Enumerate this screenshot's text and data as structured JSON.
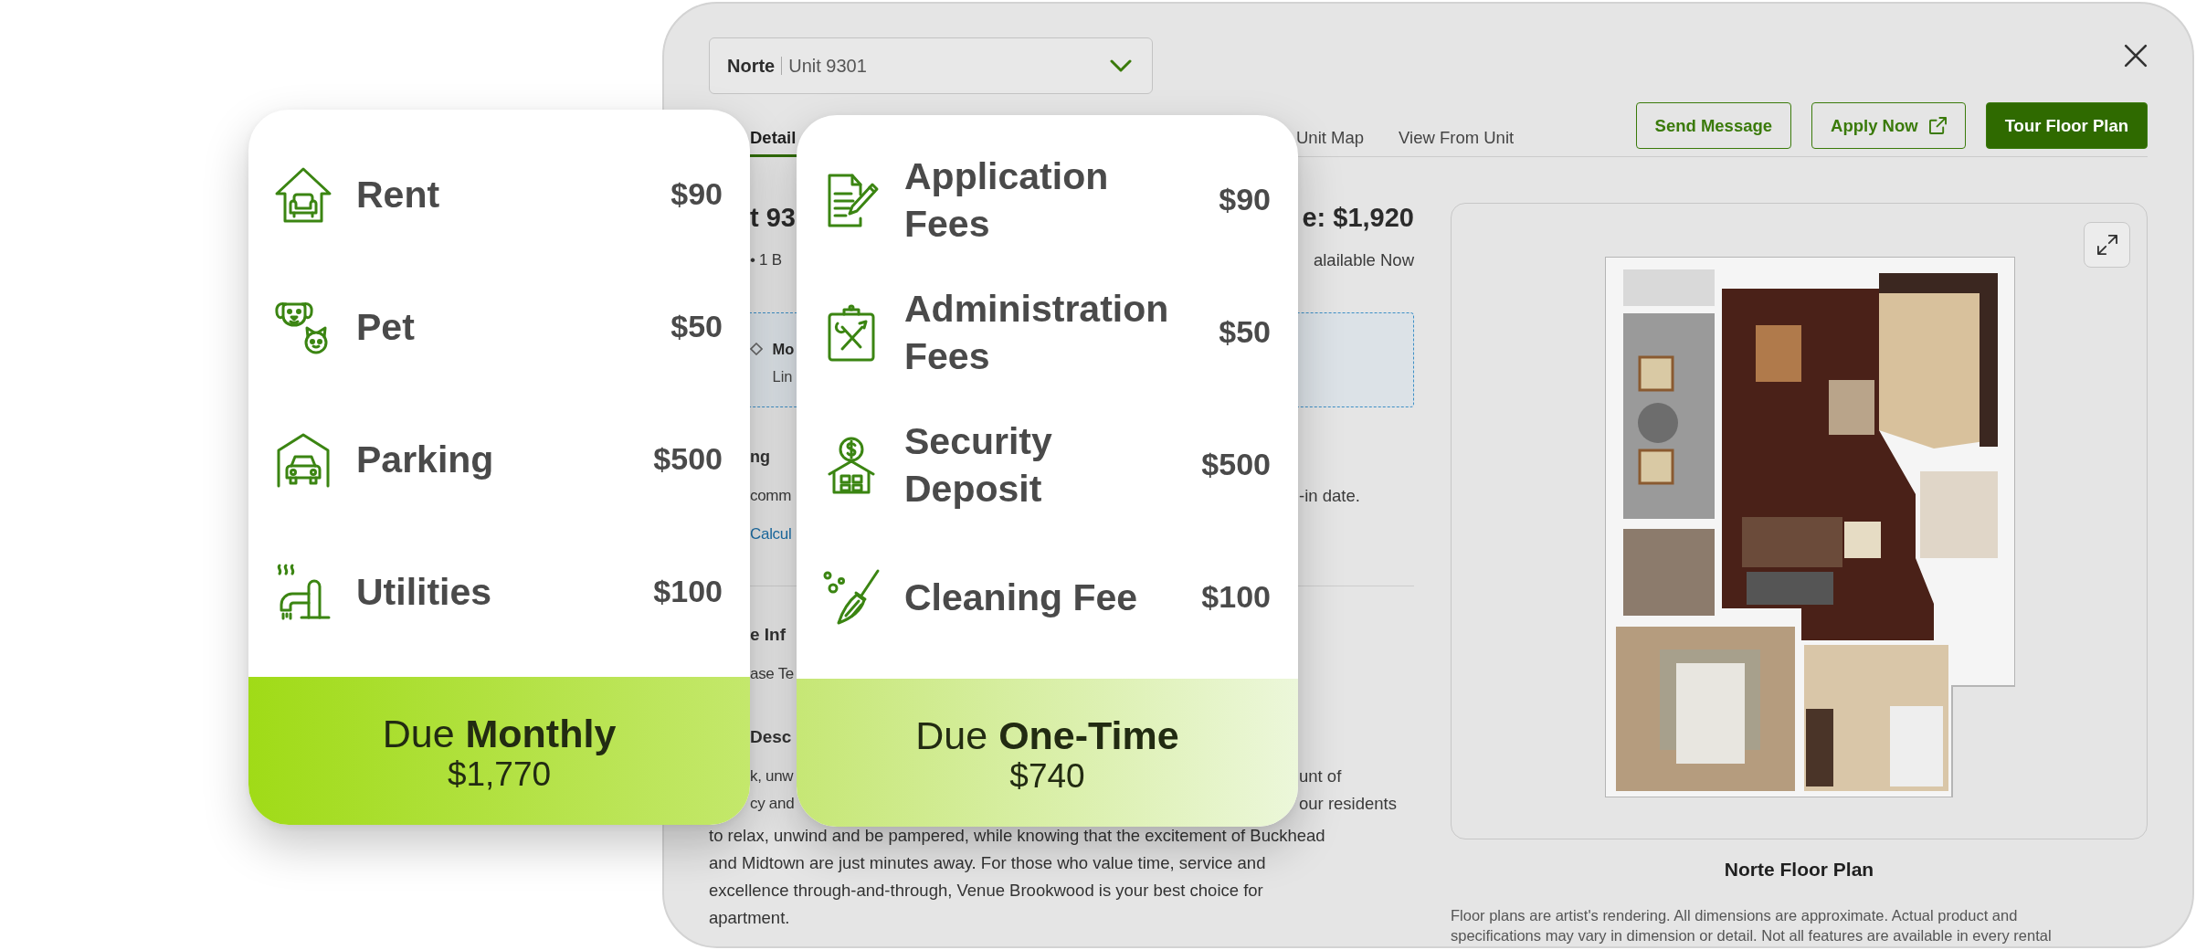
{
  "window": {
    "unit_select": {
      "property": "Norte",
      "unit": "Unit 9301"
    },
    "tabs": [
      {
        "label": "Detail",
        "selected": true
      },
      {
        "label": "Unit Map",
        "selected": false
      },
      {
        "label": "View From Unit",
        "selected": false
      }
    ],
    "actions": [
      {
        "label": "Send Message",
        "kind": "outline"
      },
      {
        "label": "Apply Now",
        "kind": "external"
      },
      {
        "label": "Tour Floor Plan",
        "kind": "primary"
      }
    ],
    "details": {
      "heading": {
        "left": "t 93",
        "right": "e: $1,920"
      },
      "summary": {
        "left": "• 1 B",
        "right": "alailable Now"
      },
      "dashed_box": {
        "title": "Mo",
        "text": "Lin"
      },
      "section_1": {
        "title": "ng",
        "text_left": "comm",
        "text_right": "-in date.",
        "link": "Calcul"
      },
      "section_2": {
        "title": "e Inf",
        "text": "ase Te"
      },
      "section_3": {
        "title": "Desc",
        "partial_lines": [
          {
            "left": "k, unw",
            "right": "unt of"
          },
          {
            "left": "cy and",
            "right": "our residents"
          }
        ],
        "lines": [
          "to relax, unwind and be pampered, while knowing that the excitement of Buckhead",
          "and Midtown are just minutes away. For those who value time, service and",
          "excellence through-and-through, Venue Brookwood is your best choice for",
          "apartment."
        ]
      }
    },
    "floor_plan": {
      "title": "Norte Floor Plan",
      "caption_lines": [
        "Floor plans are artist's rendering. All dimensions are approximate. Actual product and",
        "specifications may vary in dimension or detail. Not all features are available in every rental"
      ]
    }
  },
  "cards": [
    {
      "items": [
        {
          "label": "Rent",
          "amount": "$90"
        },
        {
          "label": "Pet",
          "amount": "$50"
        },
        {
          "label": "Parking",
          "amount": "$500"
        },
        {
          "label": "Utilities",
          "amount": "$100"
        }
      ],
      "footer": {
        "heading": "Due **Monthly**",
        "total": "$1,770"
      }
    },
    {
      "items": [
        {
          "label": "Application Fees",
          "amount": "$90"
        },
        {
          "label": "Administration Fees",
          "amount": "$50"
        },
        {
          "label": "Security Deposit",
          "amount": "$500"
        },
        {
          "label": "Cleaning Fee",
          "amount": "$100"
        }
      ],
      "footer": {
        "heading": "Due **One-Time**",
        "total": "$740"
      }
    }
  ]
}
